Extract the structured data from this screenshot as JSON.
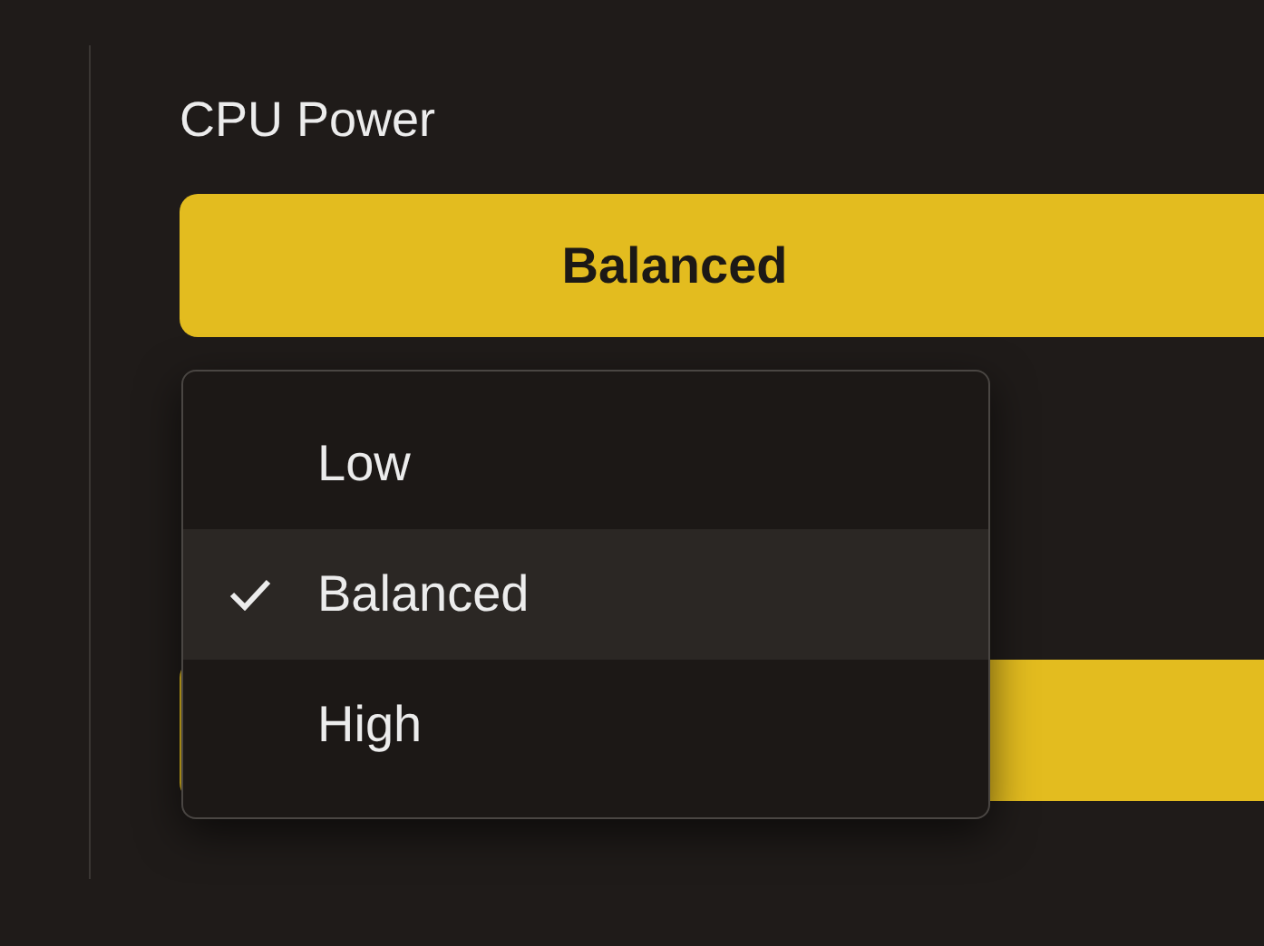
{
  "label": "CPU Power",
  "select": {
    "value": "Balanced",
    "expanded": true
  },
  "options": [
    {
      "label": "Low",
      "selected": false
    },
    {
      "label": "Balanced",
      "selected": true
    },
    {
      "label": "High",
      "selected": false
    }
  ]
}
